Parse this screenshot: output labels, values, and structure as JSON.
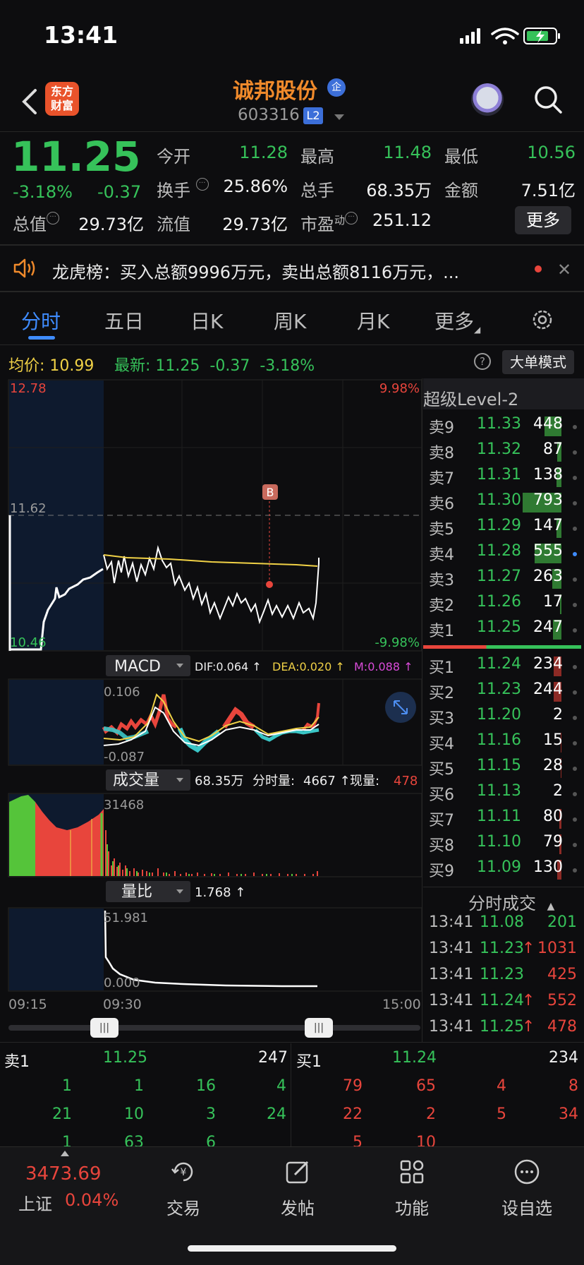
{
  "status_bar": {
    "time": "13:41"
  },
  "header": {
    "logo_text": "东方\n财富",
    "stock_name": "诚邦股份",
    "badge": "企",
    "stock_code": "603316",
    "level_badge": "L2"
  },
  "quote": {
    "last_price": "11.25",
    "change_pct": "-3.18%",
    "change": "-0.37",
    "rows": [
      [
        {
          "label": "今开",
          "value": "11.28",
          "color": "green"
        },
        {
          "label": "最高",
          "value": "11.48",
          "color": "green"
        },
        {
          "label": "最低",
          "value": "10.56",
          "color": "green"
        }
      ],
      [
        {
          "label": "换手",
          "value": "25.86%",
          "color": "white"
        },
        {
          "label": "总手",
          "value": "68.35万",
          "color": "white"
        },
        {
          "label": "金额",
          "value": "7.51亿",
          "color": "white"
        }
      ],
      [
        {
          "label": "总值",
          "value": "29.73亿",
          "color": "white"
        },
        {
          "label": "流值",
          "value": "29.73亿",
          "color": "white"
        },
        {
          "label": "市盈",
          "value": "251.12",
          "color": "white"
        }
      ]
    ],
    "pe_suffix": "动",
    "more_button": "更多"
  },
  "announcement": {
    "text": "龙虎榜：买入总额9996万元，卖出总额8116万元，..."
  },
  "tabs": [
    "分时",
    "五日",
    "日K",
    "周K",
    "月K",
    "更多"
  ],
  "avg_bar": {
    "avg_label": "均价:",
    "avg_value": "10.99",
    "latest_label": "最新:",
    "latest_value": "11.25",
    "latest_change": "-0.37",
    "latest_pct": "-3.18%",
    "help_icon": "?",
    "big_order_button": "大单模式"
  },
  "main_chart": {
    "y_top": "12.78",
    "y_mid": "11.62",
    "y_bottom": "10.46",
    "pct_top": "9.98%",
    "pct_bottom": "-9.98%",
    "buy_marker": "B"
  },
  "macd": {
    "label": "MACD",
    "dif": "DIF:0.064 ↑",
    "dea": "DEA:0.020 ↑",
    "m": "M:0.088 ↑",
    "y_top": "0.106",
    "y_bottom": "-0.087"
  },
  "volume": {
    "label": "成交量",
    "total": "68.35万",
    "minute_label": "分时量:",
    "minute_value": "4667 ↑",
    "now_label": "现量:",
    "now_value": "478",
    "y_top": "31468"
  },
  "volume_ratio": {
    "label": "量比",
    "value": "1.768 ↑",
    "y_top": "51.981",
    "y_bottom": "0.000"
  },
  "time_axis": {
    "start": "09:15",
    "open": "09:30",
    "end": "15:00"
  },
  "order_book": {
    "title": "超级Level-2",
    "asks": [
      {
        "label": "卖9",
        "price": "11.33",
        "vol": "448",
        "bar": 0.42
      },
      {
        "label": "卖8",
        "price": "11.32",
        "vol": "87",
        "bar": 0.1
      },
      {
        "label": "卖7",
        "price": "11.31",
        "vol": "138",
        "bar": 0.12
      },
      {
        "label": "卖6",
        "price": "11.30",
        "vol": "793",
        "bar": 0.98
      },
      {
        "label": "卖5",
        "price": "11.29",
        "vol": "147",
        "bar": 0.12
      },
      {
        "label": "卖4",
        "price": "11.28",
        "vol": "555",
        "bar": 0.68
      },
      {
        "label": "卖3",
        "price": "11.27",
        "vol": "263",
        "bar": 0.24
      },
      {
        "label": "卖2",
        "price": "11.26",
        "vol": "17",
        "bar": 0.03
      },
      {
        "label": "卖1",
        "price": "11.25",
        "vol": "247",
        "bar": 0.22
      }
    ],
    "bids": [
      {
        "label": "买1",
        "price": "11.24",
        "vol": "234",
        "bar": 0.2
      },
      {
        "label": "买2",
        "price": "11.23",
        "vol": "244",
        "bar": 0.2
      },
      {
        "label": "买3",
        "price": "11.20",
        "vol": "2",
        "bar": 0.0
      },
      {
        "label": "买4",
        "price": "11.16",
        "vol": "15",
        "bar": 0.01
      },
      {
        "label": "买5",
        "price": "11.15",
        "vol": "28",
        "bar": 0.02
      },
      {
        "label": "买6",
        "price": "11.13",
        "vol": "2",
        "bar": 0.0
      },
      {
        "label": "买7",
        "price": "11.11",
        "vol": "80",
        "bar": 0.06
      },
      {
        "label": "买8",
        "price": "11.10",
        "vol": "79",
        "bar": 0.06
      },
      {
        "label": "买9",
        "price": "11.09",
        "vol": "130",
        "bar": 0.1
      }
    ]
  },
  "trades": {
    "title": "分时成交",
    "rows": [
      {
        "time": "13:41",
        "price": "11.08",
        "vol": "201",
        "arrow": "",
        "vol_color": "green"
      },
      {
        "time": "13:41",
        "price": "11.23",
        "vol": "1031",
        "arrow": "↑",
        "vol_color": "red"
      },
      {
        "time": "13:41",
        "price": "11.23",
        "vol": "425",
        "arrow": "",
        "vol_color": "red"
      },
      {
        "time": "13:41",
        "price": "11.24",
        "vol": "552",
        "arrow": "↑",
        "vol_color": "red"
      },
      {
        "time": "13:41",
        "price": "11.25",
        "vol": "478",
        "arrow": "↑",
        "vol_color": "red"
      }
    ]
  },
  "queue": {
    "sell_label": "卖1",
    "sell_price": "11.25",
    "sell_total": "247",
    "buy_label": "买1",
    "buy_price": "11.24",
    "buy_total": "234",
    "sell_cells": [
      [
        "1",
        "1",
        "16",
        "4"
      ],
      [
        "21",
        "10",
        "3",
        "24"
      ],
      [
        "1",
        "63",
        "6",
        ""
      ]
    ],
    "buy_cells": [
      [
        "79",
        "65",
        "4",
        "8"
      ],
      [
        "22",
        "2",
        "5",
        "34"
      ],
      [
        "5",
        "10",
        "",
        ""
      ]
    ]
  },
  "bottom_nav": {
    "index_value": "3473.69",
    "index_name": "上证",
    "index_pct": "0.04%",
    "items": [
      "交易",
      "发帖",
      "功能",
      "设自选"
    ]
  }
}
